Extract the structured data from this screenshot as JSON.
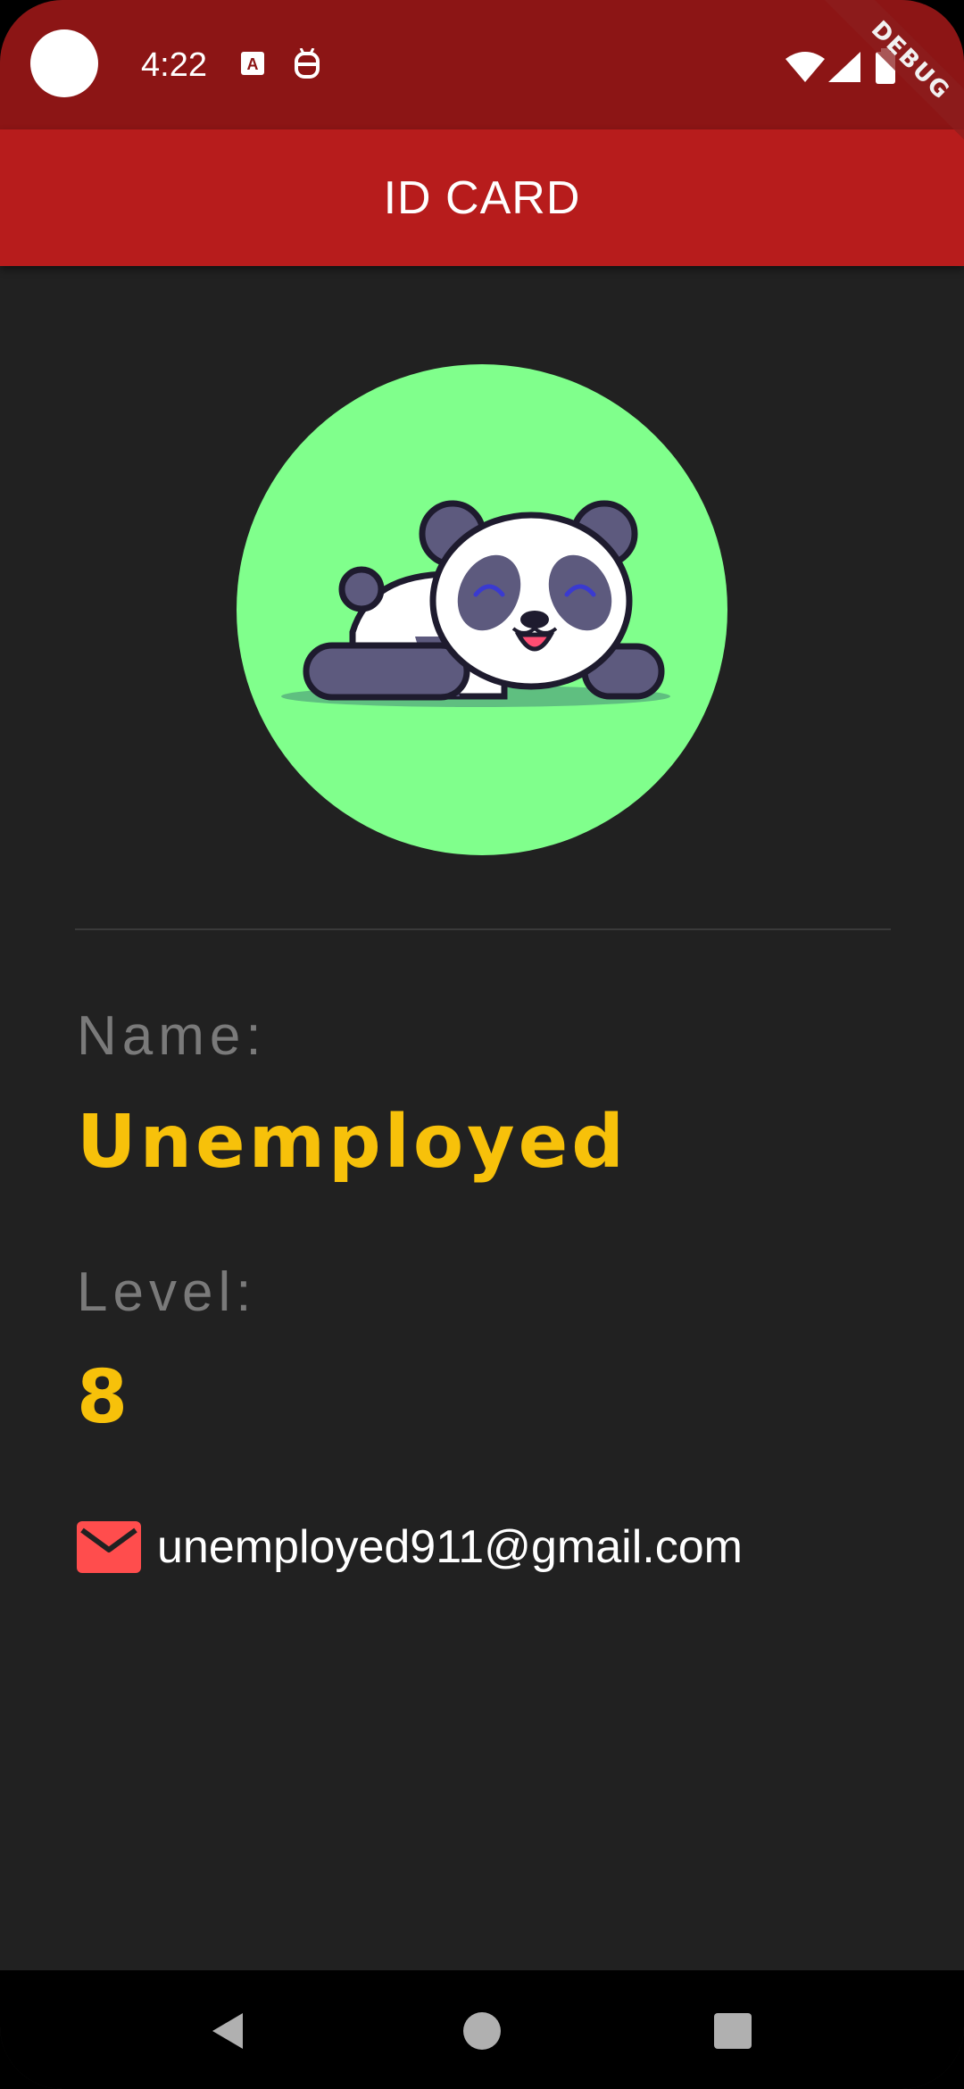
{
  "status_bar": {
    "time": "4:22",
    "icons": [
      "camera-cutout",
      "font-icon",
      "robot-icon",
      "wifi-icon",
      "signal-icon",
      "battery-icon"
    ],
    "background": "#8c1515"
  },
  "debug_banner": "DEBUG",
  "app_bar": {
    "title": "ID CARD",
    "background": "#b71c1c"
  },
  "profile": {
    "avatar_icon": "panda-icon",
    "avatar_background": "#80ff8c",
    "name_label": "Name:",
    "name_value": "Unemployed",
    "level_label": "Level:",
    "level_value": "8",
    "email": "unemployed911@gmail.com",
    "email_icon": "mail-icon"
  },
  "colors": {
    "page_background": "#212121",
    "label_color": "#7a7a7a",
    "value_color": "#f7c10a",
    "email_icon_color": "#ff4d4d"
  },
  "nav_bar": {
    "buttons": [
      "back-icon",
      "home-icon",
      "recents-icon"
    ]
  }
}
